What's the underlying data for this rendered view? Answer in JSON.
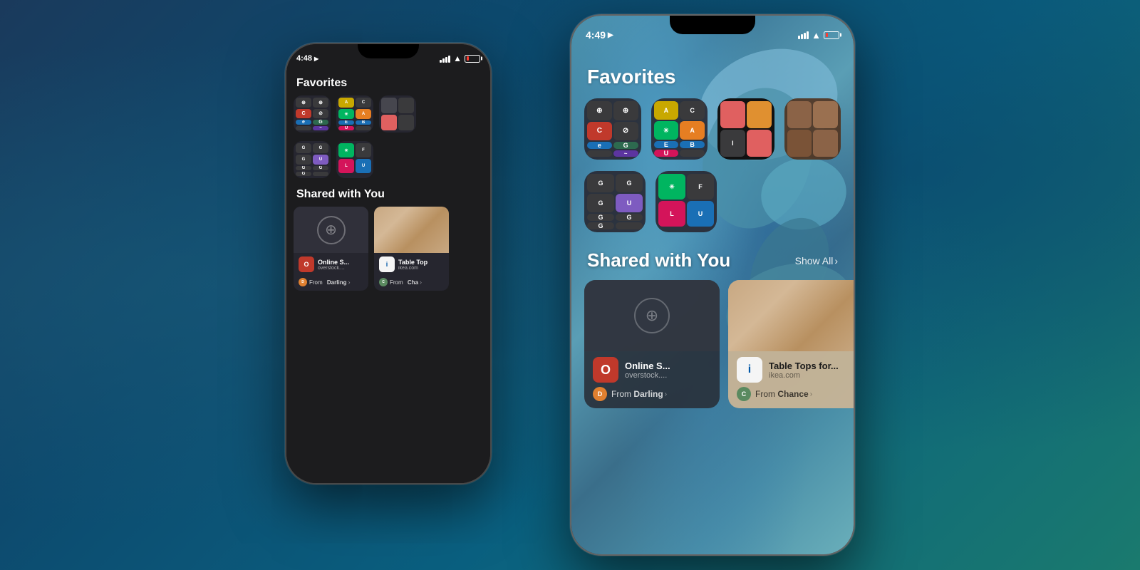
{
  "background": {
    "gradient": "linear-gradient(135deg, #1a3a5c, #0d4a6e, #0a6080, #1a7a6e)"
  },
  "phone_back": {
    "time": "4:48",
    "section": "Favorites",
    "shared_section": "Shared with You",
    "cards": [
      {
        "name": "Online S...",
        "domain": "overstock....",
        "from_label": "From",
        "from_name": "Darling",
        "app_color": "#c0392b"
      },
      {
        "name": "Table Top",
        "domain": "ikea.com",
        "from_label": "From",
        "from_name": "Cha",
        "app_color": "#f5f5f5"
      }
    ]
  },
  "phone_front": {
    "time": "4:49",
    "section": "Favorites",
    "shared_section": "Shared with You",
    "show_all": "Show All",
    "cards": [
      {
        "name": "Online S...",
        "domain": "overstock....",
        "from_label": "From",
        "from_name": "Darling",
        "app_color": "#c0392b"
      },
      {
        "name": "Table Tops for...",
        "domain": "ikea.com",
        "from_label": "From",
        "from_name": "Chance",
        "app_color": "#f5f5f5"
      }
    ]
  }
}
